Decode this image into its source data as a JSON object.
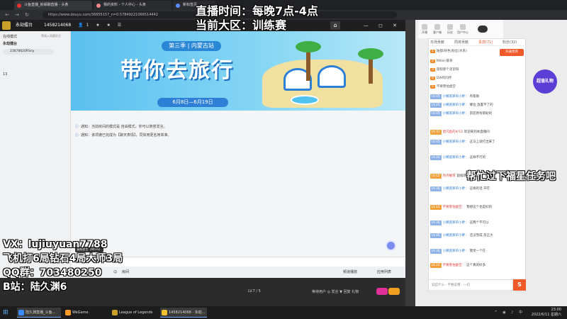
{
  "browser": {
    "tabs": [
      "斗鱼直播_就缘聊直播 - 头条",
      "我的资料 - 个人中心 - 头条",
      "新标签页"
    ],
    "url": "https://www.douyu.com/36855157_n=0.57849221066514442",
    "back_icon": "arrow-left-icon",
    "forward_icon": "arrow-right-icon",
    "refresh_icon": "refresh-icon"
  },
  "qq": {
    "room_name": "永劫擂台",
    "room_number": "1458214068",
    "title_icons": "👤1 ★ ★ ☰",
    "window_controls": "— ◻ ✕",
    "home_icon": "home-icon",
    "sidebar": {
      "header_left": "在线模式",
      "header_right": "等候入同赛区位",
      "group": "永劫擂台",
      "count": "13",
      "member": "23878620RSny",
      "search_placeholder": "搜索"
    },
    "banner": {
      "season": "第三季 | 内蒙古站",
      "title": "带你去旅行",
      "dates": "6月8日—6月19日"
    },
    "notices": [
      "通知：当前房间的模式是 自由模式，你可以随意发言。",
      "通知：该项遵已完成为【聊天表情】，同体用更名用单准。"
    ],
    "chat_bubble": "复制发言（Alt+S）",
    "toolbar_label": "房间",
    "toolbar_right": [
      "频道播放",
      "应用列表"
    ]
  },
  "lower": {
    "status_text": "等待用户 ◎ 发言 ▼ 回复 礼物",
    "lvl_text": "LV.7 / 5"
  },
  "live": {
    "top_icons": [
      {
        "name": "feature-1-icon",
        "label": "开播"
      },
      {
        "name": "feature-2-icon",
        "label": "客户端"
      },
      {
        "name": "feature-3-icon",
        "label": "历史"
      },
      {
        "name": "feature-4-icon",
        "label": "用户中心"
      }
    ],
    "panel_tabs": [
      "日场贡献",
      "周排贡献",
      "贵宾(71)",
      "粉丝(32)"
    ],
    "join_button": "开通贵宾",
    "rank": [
      {
        "tag": "1",
        "text": "陆都(粉色)粉丝(水系)"
      },
      {
        "tag": "2",
        "text": "Miller/豪哥"
      },
      {
        "tag": "3",
        "text": "旅程那个弟弟呀"
      },
      {
        "tag": "4",
        "text": "DW的同伴"
      },
      {
        "tag": "5",
        "text": "不要害怕虚空"
      }
    ],
    "messages": [
      {
        "lv": "LV.35",
        "name": "小狮逃萝的小胖：",
        "text": "有帮助"
      },
      {
        "lv": "LV.25",
        "name": "小狮逃萝的小胖：",
        "text": "哪位 放置不了的"
      },
      {
        "lv": "LV.35",
        "name": "小狮逃萝的小胖：",
        "text": "昂您原有帮助的"
      },
      {
        "lv": "LV.31",
        "name": "星闪鱼的4/13",
        "text": "欢迎来到本直播间"
      },
      {
        "lv": "LV.35",
        "name": "小狮逃萝的小胖：",
        "text": "这马上就打出来了"
      },
      {
        "lv": "LV.35",
        "name": "小狮逃萝的小胖：",
        "text": "这样不行的"
      },
      {
        "lv": "LV.15",
        "name": "热点推荐",
        "text": "超级新服区"
      },
      {
        "lv": "LV.35",
        "name": "小狮逃萝的小胖：",
        "text": "这样的话 开在"
      },
      {
        "lv": "LV.15",
        "name": "不要害怕虚空：",
        "text": "我想这个也是好的"
      },
      {
        "lv": "LV.35",
        "name": "小狮逃萝的小胖：",
        "text": "这两个不可以"
      },
      {
        "lv": "LV.35",
        "name": "小狮逃萝的小胖：",
        "text": "还没完成 反正大"
      },
      {
        "lv": "LV.35",
        "name": "小狮逃萝的小胖：",
        "text": "我觉一个在"
      },
      {
        "lv": "LV.15",
        "name": "不要害怕虚空：",
        "text": "这个真的好多"
      }
    ],
    "input_placeholder": "说些什么 - 不要说哦 · 一切",
    "send_label": "S",
    "gift_label": "超值礼物"
  },
  "overlay": {
    "live_time": "直播时间：每晚7点-4点",
    "region": "当前大区：训练赛",
    "help": "帮忙过下福星任务吧",
    "vx": "VX：lujiuyuan7788",
    "record": "飞机打6局钻石4局大师3局",
    "qq_group": "QQ群：703480250",
    "bilibili": "B站：陆久渊6"
  },
  "taskbar": {
    "items": [
      {
        "label": "陆久渊直播_斗鱼...",
        "color": "#3a8bff"
      },
      {
        "label": "WeGame",
        "color": "#ff9a2a"
      },
      {
        "label": "League of Legends",
        "color": "#c9a028"
      },
      {
        "label": "1458214068 · 永劫...",
        "color": "#f0c030"
      }
    ],
    "tray": "^ ◉ ♪ 中",
    "time": "23:00",
    "date": "2022/6/11 星期六"
  }
}
